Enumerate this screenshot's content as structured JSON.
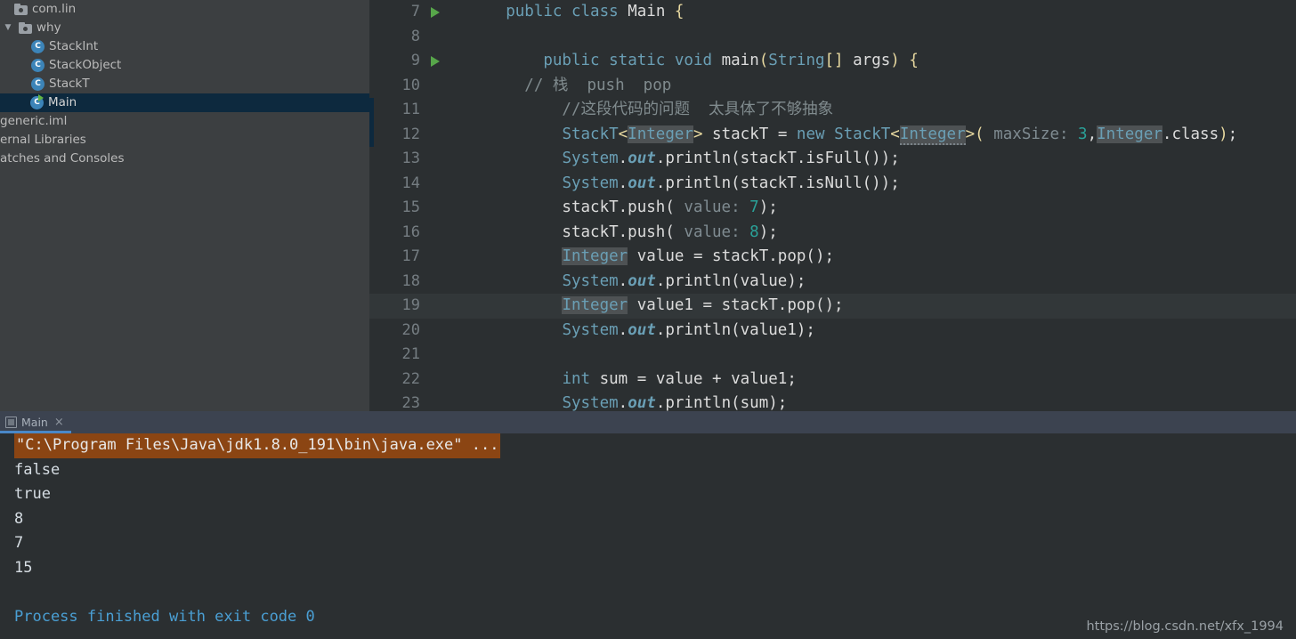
{
  "project_tree": {
    "items": [
      {
        "label": "com.lin",
        "icon": "package-folder-icon",
        "indent": 0,
        "twisty": "",
        "selected": false,
        "type": "package"
      },
      {
        "label": "why",
        "icon": "package-folder-icon",
        "indent": 1,
        "twisty": "▼",
        "selected": false,
        "type": "package"
      },
      {
        "label": "StackInt",
        "icon": "java-class-icon",
        "indent": 2,
        "twisty": "",
        "selected": false,
        "type": "class"
      },
      {
        "label": "StackObject",
        "icon": "java-class-icon",
        "indent": 2,
        "twisty": "",
        "selected": false,
        "type": "class"
      },
      {
        "label": "StackT",
        "icon": "java-class-icon",
        "indent": 2,
        "twisty": "",
        "selected": false,
        "type": "class"
      },
      {
        "label": "Main",
        "icon": "java-class-runnable-icon",
        "indent": 1,
        "twisty": "",
        "selected": true,
        "type": "class-runnable"
      }
    ],
    "clipped_items": [
      {
        "label": "generic.iml"
      },
      {
        "label": "ernal Libraries"
      },
      {
        "label": "atches and Consoles"
      }
    ],
    "class_icon_letter": "C"
  },
  "editor": {
    "lines": [
      {
        "number": "7",
        "run_arrow": true,
        "caret": false,
        "blue_mark": false,
        "tokens": [
          {
            "t": "      ",
            "c": "plain"
          },
          {
            "t": "public",
            "c": "kw2"
          },
          {
            "t": " ",
            "c": "plain"
          },
          {
            "t": "class",
            "c": "kw2"
          },
          {
            "t": " ",
            "c": "plain"
          },
          {
            "t": "Main",
            "c": "plain"
          },
          {
            "t": " ",
            "c": "plain"
          },
          {
            "t": "{",
            "c": "brace"
          }
        ]
      },
      {
        "number": "8",
        "run_arrow": false,
        "caret": false,
        "blue_mark": false,
        "tokens": []
      },
      {
        "number": "9",
        "run_arrow": true,
        "caret": false,
        "blue_mark": false,
        "tokens": [
          {
            "t": "          ",
            "c": "plain"
          },
          {
            "t": "public",
            "c": "kw2"
          },
          {
            "t": " ",
            "c": "plain"
          },
          {
            "t": "static",
            "c": "kw2"
          },
          {
            "t": " ",
            "c": "plain"
          },
          {
            "t": "void",
            "c": "kw2"
          },
          {
            "t": " ",
            "c": "plain"
          },
          {
            "t": "main",
            "c": "plain"
          },
          {
            "t": "(",
            "c": "brace"
          },
          {
            "t": "String",
            "c": "cls"
          },
          {
            "t": "[]",
            "c": "brace"
          },
          {
            "t": " args",
            "c": "plain"
          },
          {
            "t": ")",
            "c": "brace"
          },
          {
            "t": " ",
            "c": "plain"
          },
          {
            "t": "{",
            "c": "brace"
          }
        ]
      },
      {
        "number": "10",
        "run_arrow": false,
        "caret": false,
        "blue_mark": false,
        "tokens": [
          {
            "t": "        // 栈  push  pop",
            "c": "cmt"
          }
        ]
      },
      {
        "number": "11",
        "run_arrow": false,
        "caret": false,
        "blue_mark": true,
        "tokens": [
          {
            "t": "            //这段代码的问题  太具体了不够抽象",
            "c": "cmt"
          }
        ]
      },
      {
        "number": "12",
        "run_arrow": false,
        "caret": false,
        "blue_mark": true,
        "tokens": [
          {
            "t": "            ",
            "c": "plain"
          },
          {
            "t": "StackT",
            "c": "cls"
          },
          {
            "t": "<",
            "c": "brace"
          },
          {
            "t": "Integer",
            "c": "cls",
            "hl": true
          },
          {
            "t": ">",
            "c": "brace"
          },
          {
            "t": " stackT ",
            "c": "plain"
          },
          {
            "t": "=",
            "c": "plain"
          },
          {
            "t": " ",
            "c": "plain"
          },
          {
            "t": "new",
            "c": "kw2"
          },
          {
            "t": " ",
            "c": "plain"
          },
          {
            "t": "StackT",
            "c": "cls"
          },
          {
            "t": "<",
            "c": "brace"
          },
          {
            "t": "Integer",
            "c": "cls",
            "hlw": true
          },
          {
            "t": ">",
            "c": "brace"
          },
          {
            "t": "(",
            "c": "brace"
          },
          {
            "t": " maxSize: ",
            "c": "hint"
          },
          {
            "t": "3",
            "c": "num"
          },
          {
            "t": ",",
            "c": "plain"
          },
          {
            "t": "Integer",
            "c": "cls",
            "hl": true
          },
          {
            "t": ".class",
            "c": "plain"
          },
          {
            "t": ")",
            "c": "brace"
          },
          {
            "t": ";",
            "c": "plain"
          }
        ]
      },
      {
        "number": "13",
        "run_arrow": false,
        "caret": false,
        "blue_mark": false,
        "tokens": [
          {
            "t": "            ",
            "c": "plain"
          },
          {
            "t": "System",
            "c": "cls"
          },
          {
            "t": ".",
            "c": "plain"
          },
          {
            "t": "out",
            "c": "fld"
          },
          {
            "t": ".println(stackT.isFull())",
            "c": "plain"
          },
          {
            "t": ";",
            "c": "plain"
          }
        ]
      },
      {
        "number": "14",
        "run_arrow": false,
        "caret": false,
        "blue_mark": false,
        "tokens": [
          {
            "t": "            ",
            "c": "plain"
          },
          {
            "t": "System",
            "c": "cls"
          },
          {
            "t": ".",
            "c": "plain"
          },
          {
            "t": "out",
            "c": "fld"
          },
          {
            "t": ".println(stackT.isNull())",
            "c": "plain"
          },
          {
            "t": ";",
            "c": "plain"
          }
        ]
      },
      {
        "number": "15",
        "run_arrow": false,
        "caret": false,
        "blue_mark": false,
        "tokens": [
          {
            "t": "            stackT.push(",
            "c": "plain"
          },
          {
            "t": " value: ",
            "c": "hint"
          },
          {
            "t": "7",
            "c": "num"
          },
          {
            "t": ");",
            "c": "plain"
          }
        ]
      },
      {
        "number": "16",
        "run_arrow": false,
        "caret": false,
        "blue_mark": false,
        "tokens": [
          {
            "t": "            stackT.push(",
            "c": "plain"
          },
          {
            "t": " value: ",
            "c": "hint"
          },
          {
            "t": "8",
            "c": "num"
          },
          {
            "t": ");",
            "c": "plain"
          }
        ]
      },
      {
        "number": "17",
        "run_arrow": false,
        "caret": false,
        "blue_mark": false,
        "tokens": [
          {
            "t": "            ",
            "c": "plain"
          },
          {
            "t": "Integer",
            "c": "cls",
            "hl": true
          },
          {
            "t": " value ",
            "c": "plain"
          },
          {
            "t": "=",
            "c": "plain"
          },
          {
            "t": " stackT.pop();",
            "c": "plain"
          }
        ]
      },
      {
        "number": "18",
        "run_arrow": false,
        "caret": false,
        "blue_mark": false,
        "tokens": [
          {
            "t": "            ",
            "c": "plain"
          },
          {
            "t": "System",
            "c": "cls"
          },
          {
            "t": ".",
            "c": "plain"
          },
          {
            "t": "out",
            "c": "fld"
          },
          {
            "t": ".println(value);",
            "c": "plain"
          }
        ]
      },
      {
        "number": "19",
        "run_arrow": false,
        "caret": true,
        "blue_mark": false,
        "tokens": [
          {
            "t": "            ",
            "c": "plain"
          },
          {
            "t": "Integer",
            "c": "cls",
            "hl": true
          },
          {
            "t": " value1 ",
            "c": "plain"
          },
          {
            "t": "=",
            "c": "plain"
          },
          {
            "t": " stackT.pop();",
            "c": "plain"
          }
        ]
      },
      {
        "number": "20",
        "run_arrow": false,
        "caret": false,
        "blue_mark": false,
        "tokens": [
          {
            "t": "            ",
            "c": "plain"
          },
          {
            "t": "System",
            "c": "cls"
          },
          {
            "t": ".",
            "c": "plain"
          },
          {
            "t": "out",
            "c": "fld"
          },
          {
            "t": ".println(value1);",
            "c": "plain"
          }
        ]
      },
      {
        "number": "21",
        "run_arrow": false,
        "caret": false,
        "blue_mark": false,
        "tokens": []
      },
      {
        "number": "22",
        "run_arrow": false,
        "caret": false,
        "blue_mark": false,
        "tokens": [
          {
            "t": "            ",
            "c": "plain"
          },
          {
            "t": "int",
            "c": "kw2"
          },
          {
            "t": " sum ",
            "c": "plain"
          },
          {
            "t": "=",
            "c": "plain"
          },
          {
            "t": " value ",
            "c": "plain"
          },
          {
            "t": "+",
            "c": "plain"
          },
          {
            "t": " value1;",
            "c": "plain"
          }
        ]
      },
      {
        "number": "23",
        "run_arrow": false,
        "caret": false,
        "blue_mark": false,
        "tokens": [
          {
            "t": "            ",
            "c": "plain"
          },
          {
            "t": "System",
            "c": "cls"
          },
          {
            "t": ".",
            "c": "plain"
          },
          {
            "t": "out",
            "c": "fld"
          },
          {
            "t": ".println(sum);",
            "c": "plain"
          }
        ]
      }
    ]
  },
  "run_panel": {
    "tab_label": "Main",
    "tab_close": "×",
    "console_lines": [
      {
        "text": "\"C:\\Program Files\\Java\\jdk1.8.0_191\\bin\\java.exe\" ...",
        "style": "command"
      },
      {
        "text": "false",
        "style": "white"
      },
      {
        "text": "true",
        "style": "white"
      },
      {
        "text": "8",
        "style": "white"
      },
      {
        "text": "7",
        "style": "white"
      },
      {
        "text": "15",
        "style": "white"
      },
      {
        "text": "",
        "style": "white"
      },
      {
        "text": "Process finished with exit code 0",
        "style": "blue"
      }
    ]
  },
  "watermark": {
    "text": "https://blog.csdn.net/xfx_1994"
  },
  "colors": {
    "editor_bg": "#2b2f31",
    "sidebar_bg": "#3c3f41",
    "selection_bg": "#0d293e",
    "tabbar_bg": "#3c4350",
    "tab_underline": "#4a88c7",
    "command_bg": "#8b4513",
    "console_blue": "#4a9fd4",
    "run_arrow_green": "#57a64a",
    "class_icon_blue": "#3c84b8"
  }
}
